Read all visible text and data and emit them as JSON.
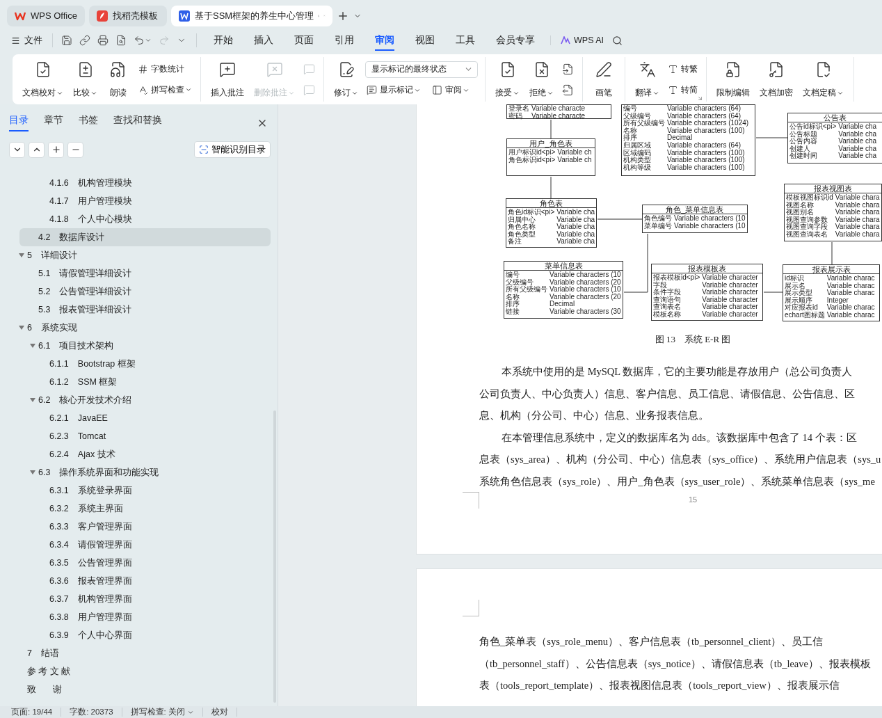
{
  "browser_tabs": [
    {
      "label": "WPS Office",
      "selected": false
    },
    {
      "label": "找稻壳模板",
      "selected": false
    },
    {
      "label": "基于SSM框架的养生中心管理",
      "selected": true
    }
  ],
  "quick_tools": [
    {
      "disabled": false,
      "dropdown": false
    },
    {
      "disabled": false,
      "dropdown": false
    },
    {
      "disabled": false,
      "dropdown": false
    },
    {
      "disabled": false,
      "dropdown": false
    },
    {
      "disabled": false,
      "dropdown": true
    },
    {
      "disabled": true,
      "dropdown": false
    },
    {
      "disabled": false
    }
  ],
  "file_menu": "文件",
  "menu_tabs": [
    {
      "label": "开始",
      "selected": false
    },
    {
      "label": "插入",
      "selected": false
    },
    {
      "label": "页面",
      "selected": false
    },
    {
      "label": "引用",
      "selected": false
    },
    {
      "label": "审阅",
      "selected": true
    },
    {
      "label": "视图",
      "selected": false
    },
    {
      "label": "工具",
      "selected": false
    },
    {
      "label": "会员专享",
      "selected": false
    }
  ],
  "ai_label": "WPS AI",
  "ribbon": {
    "groups": [
      {
        "items": [
          {
            "kind": "large",
            "label": "文档校对",
            "dropdown": true,
            "disabled": false
          },
          {
            "kind": "large",
            "label": "比较",
            "dropdown": true,
            "disabled": false
          },
          {
            "kind": "large",
            "label": "朗读",
            "dropdown": false,
            "disabled": false
          },
          {
            "kind": "stack",
            "rows": [
              [
                {
                  "kind": "small",
                  "label": "字数统计",
                  "dropdown": false,
                  "disabled": false
                }
              ],
              [
                {
                  "kind": "small",
                  "label": "拼写检查",
                  "dropdown": true,
                  "disabled": false
                }
              ]
            ]
          }
        ]
      },
      {
        "items": [
          {
            "kind": "large",
            "label": "插入批注",
            "dropdown": false,
            "disabled": false
          },
          {
            "kind": "large",
            "label": "删除批注",
            "dropdown": true,
            "disabled": true
          },
          {
            "kind": "stack",
            "rows": [
              [
                {
                  "kind": "icon",
                  "disabled": true
                }
              ],
              [
                {
                  "kind": "icon",
                  "disabled": true
                }
              ]
            ]
          }
        ]
      },
      {
        "items": [
          {
            "kind": "large",
            "label": "修订",
            "dropdown": true,
            "disabled": false
          },
          {
            "kind": "stack",
            "rows": [
              [
                {
                  "kind": "select",
                  "value": "显示标记的最终状态"
                }
              ],
              [
                {
                  "kind": "small",
                  "label": "显示标记",
                  "dropdown": true,
                  "disabled": false
                },
                {
                  "kind": "small",
                  "label": "审阅",
                  "dropdown": true,
                  "disabled": false
                }
              ]
            ]
          }
        ]
      },
      {
        "items": [
          {
            "kind": "large",
            "label": "接受",
            "dropdown": true,
            "disabled": false
          },
          {
            "kind": "large",
            "label": "拒绝",
            "dropdown": true,
            "disabled": false
          },
          {
            "kind": "stack",
            "rows": [
              [
                {
                  "kind": "icon",
                  "disabled": false
                }
              ],
              [
                {
                  "kind": "icon",
                  "disabled": false
                }
              ]
            ]
          }
        ]
      },
      {
        "items": [
          {
            "kind": "large",
            "label": "画笔",
            "dropdown": false,
            "disabled": false
          }
        ]
      },
      {
        "items": [
          {
            "kind": "large",
            "label": "翻译",
            "dropdown": true,
            "disabled": false
          },
          {
            "kind": "stack",
            "rows": [
              [
                {
                  "kind": "small",
                  "label": "转繁",
                  "dropdown": false,
                  "disabled": false
                }
              ],
              [
                {
                  "kind": "small",
                  "label": "转简",
                  "dropdown": false,
                  "disabled": false
                }
              ]
            ]
          }
        ]
      },
      {
        "items": [
          {
            "kind": "large",
            "label": "限制编辑",
            "dropdown": false,
            "disabled": false
          },
          {
            "kind": "large",
            "label": "文档加密",
            "dropdown": false,
            "disabled": false
          },
          {
            "kind": "large",
            "label": "文档定稿",
            "dropdown": true,
            "disabled": false
          }
        ]
      }
    ]
  },
  "panel": {
    "tabs": [
      {
        "label": "目录",
        "selected": true
      },
      {
        "label": "章节",
        "selected": false
      },
      {
        "label": "书签",
        "selected": false
      },
      {
        "label": "查找和替换",
        "selected": false
      }
    ],
    "smart_button": "智能识别目录",
    "outline": [
      {
        "children": [
          {
            "children": [
              {
                "number": "4.1.6",
                "title": "机构管理模块",
                "selected": false
              },
              {
                "number": "4.1.7",
                "title": "用户管理模块",
                "selected": false
              },
              {
                "number": "4.1.8",
                "title": "个人中心模块",
                "selected": false
              }
            ]
          },
          {
            "number": "4.2",
            "title": "数据库设计",
            "selected": true
          }
        ]
      },
      {
        "number": "5",
        "title": "详细设计",
        "selected": false,
        "expanded": true,
        "children": [
          {
            "number": "5.1",
            "title": "请假管理详细设计",
            "selected": false
          },
          {
            "number": "5.2",
            "title": "公告管理详细设计",
            "selected": false
          },
          {
            "number": "5.3",
            "title": "报表管理详细设计",
            "selected": false
          }
        ]
      },
      {
        "number": "6",
        "title": "系统实现",
        "selected": false,
        "expanded": true,
        "children": [
          {
            "number": "6.1",
            "title": "项目技术架构",
            "selected": false,
            "expanded": true,
            "children": [
              {
                "number": "6.1.1",
                "title": "Bootstrap 框架",
                "selected": false
              },
              {
                "number": "6.1.2",
                "title": "SSM 框架",
                "selected": false
              }
            ]
          },
          {
            "number": "6.2",
            "title": "核心开发技术介绍",
            "selected": false,
            "expanded": true,
            "children": [
              {
                "number": "6.2.1",
                "title": "JavaEE",
                "selected": false
              },
              {
                "number": "6.2.3",
                "title": "Tomcat",
                "selected": false
              },
              {
                "number": "6.2.4",
                "title": "Ajax 技术",
                "selected": false
              }
            ]
          },
          {
            "number": "6.3",
            "title": "操作系统界面和功能实现",
            "selected": false,
            "expanded": true,
            "children": [
              {
                "number": "6.3.1",
                "title": "系统登录界面",
                "selected": false
              },
              {
                "number": "6.3.2",
                "title": "系统主界面",
                "selected": false
              },
              {
                "number": "6.3.3",
                "title": "客户管理界面",
                "selected": false
              },
              {
                "number": "6.3.4",
                "title": "请假管理界面",
                "selected": false
              },
              {
                "number": "6.3.5",
                "title": "公告管理界面",
                "selected": false
              },
              {
                "number": "6.3.6",
                "title": "报表管理界面",
                "selected": false
              },
              {
                "number": "6.3.7",
                "title": "机构管理界面",
                "selected": false
              },
              {
                "number": "6.3.8",
                "title": "用户管理界面",
                "selected": false
              },
              {
                "number": "6.3.9",
                "title": "个人中心界面",
                "selected": false
              }
            ]
          }
        ]
      },
      {
        "number": "7",
        "title": "结语",
        "selected": false
      },
      {
        "title": "参 考 文 献",
        "selected": false
      },
      {
        "title": "致       谢",
        "selected": false
      }
    ]
  },
  "diagram": {
    "entities": [
      {
        "rows": [
          {
            "name": "登录名",
            "type": "Variable characte"
          },
          {
            "name": "密码",
            "type": "Variable characte"
          }
        ]
      },
      {
        "title": "用户_角色表",
        "rows": [
          {
            "name": "用户标识id<pi>",
            "type": "Variable ch"
          },
          {
            "name": "角色标识id<pi>",
            "type": "Variable ch"
          }
        ]
      },
      {
        "rows": [
          {
            "name": "编号",
            "type": "Variable characters (64)"
          },
          {
            "name": "父级编号",
            "type": "Variable characters (64)"
          },
          {
            "name": "所有父级编号",
            "type": "Variable characters (1024)"
          },
          {
            "name": "名称",
            "type": "Variable characters (100)"
          },
          {
            "name": "排序",
            "type": "Decimal"
          },
          {
            "name": "归属区域",
            "type": "Variable characters (64)"
          },
          {
            "name": "区域编码",
            "type": "Variable characters (100)"
          },
          {
            "name": "机构类型",
            "type": "Variable characters (100)"
          },
          {
            "name": "机构等级",
            "type": "Variable characters (100)"
          }
        ]
      },
      {
        "title": "公告表",
        "rows": [
          {
            "name": "公告id标识<pi>",
            "type": "Variable cha"
          },
          {
            "name": "公告标题",
            "type": "Variable cha"
          },
          {
            "name": "公告内容",
            "type": "Variable cha"
          },
          {
            "name": "创建人",
            "type": "Variable cha"
          },
          {
            "name": "创建时间",
            "type": "Variable cha"
          }
        ]
      },
      {
        "title": "角色表",
        "rows": [
          {
            "name": "角色id标识<pi>",
            "type": "Variable cha"
          },
          {
            "name": "归属中心",
            "type": "Variable cha"
          },
          {
            "name": "角色名称",
            "type": "Variable cha"
          },
          {
            "name": "角色类型",
            "type": "Variable cha"
          },
          {
            "name": "备注",
            "type": "Variable cha"
          }
        ]
      },
      {
        "title": "角色_菜单信息表",
        "rows": [
          {
            "name": "角色编号",
            "type": "Variable characters (10"
          },
          {
            "name": "菜单编号",
            "type": "Variable characters (10"
          }
        ]
      },
      {
        "title": "报表视图表",
        "rows": [
          {
            "name": "模板视图标识id",
            "type": "Variable chara"
          },
          {
            "name": "视图名称",
            "type": "Variable chara"
          },
          {
            "name": "视图别名",
            "type": "Variable chara"
          },
          {
            "name": "视图查询参数",
            "type": "Variable chara"
          },
          {
            "name": "视图查询字段",
            "type": "Variable chara"
          },
          {
            "name": "视图查询表名",
            "type": "Variable chara"
          }
        ]
      },
      {
        "title": "菜单信息表",
        "rows": [
          {
            "name": "编号",
            "type": "Variable characters (10"
          },
          {
            "name": "父级编号",
            "type": "Variable characters (20"
          },
          {
            "name": "所有父级编号",
            "type": "Variable characters (10"
          },
          {
            "name": "名称",
            "type": "Variable characters (20"
          },
          {
            "name": "排序",
            "type": "Decimal"
          },
          {
            "name": "链接",
            "type": "Variable characters (30"
          }
        ]
      },
      {
        "title": "报表模板表",
        "rows": [
          {
            "name": "报表模板id<pi>",
            "type": "Variable character"
          },
          {
            "name": "字段",
            "type": "Variable character"
          },
          {
            "name": "条件字段",
            "type": "Variable character"
          },
          {
            "name": "查询语句",
            "type": "Variable character"
          },
          {
            "name": "查询表名",
            "type": "Variable character"
          },
          {
            "name": "模板名称",
            "type": "Variable character"
          }
        ]
      },
      {
        "title": "报表展示表",
        "rows": [
          {
            "name": "id标识",
            "type": "Variable charac"
          },
          {
            "name": "展示名",
            "type": "Variable charac"
          },
          {
            "name": "展示类型",
            "type": "Variable charac"
          },
          {
            "name": "展示顺序",
            "type": "Integer"
          },
          {
            "name": "对应报表id",
            "type": "Variable charac"
          },
          {
            "name": "echart图标题",
            "type": "Variable charac"
          }
        ]
      }
    ]
  },
  "caption": "图 13　系统 E-R 图",
  "page1_paragraphs": [
    {
      "first_line_indent": true,
      "lines": [
        "本系统中使用的是 MySQL 数据库，它的主要功能是存放用户（总公司负责人",
        "公司负责人、中心负责人）信息、客户信息、员工信息、请假信息、公告信息、区",
        "息、机构（分公司、中心）信息、业务报表信息。"
      ]
    },
    {
      "first_line_indent": true,
      "lines": [
        "在本管理信息系统中，定义的数据库名为 dds。该数据库中包含了 14 个表：区",
        "息表（sys_area）、机构（分公司、中心）信息表（sys_office）、系统用户信息表（sys_u",
        "系统角色信息表（sys_role）、用户_角色表（sys_user_role）、系统菜单信息表（sys_me"
      ]
    }
  ],
  "page_number": "15",
  "page2_paragraphs": [
    {
      "first_line_indent": false,
      "lines": [
        "角色_菜单表（sys_role_menu）、客户信息表（tb_personnel_client）、员工信",
        "（tb_personnel_staff）、公告信息表（sys_notice）、请假信息表（tb_leave）、报表模板",
        "表（tools_report_template）、报表视图信息表（tools_report_view）、报表展示信"
      ]
    }
  ],
  "status_bar": [
    {
      "label": "页面: 19/44",
      "dropdown": false
    },
    {
      "label": "字数: 20373",
      "dropdown": false
    },
    {
      "label": "拼写检查: 关闭",
      "dropdown": true
    },
    {
      "label": "校对",
      "dropdown": false
    }
  ]
}
